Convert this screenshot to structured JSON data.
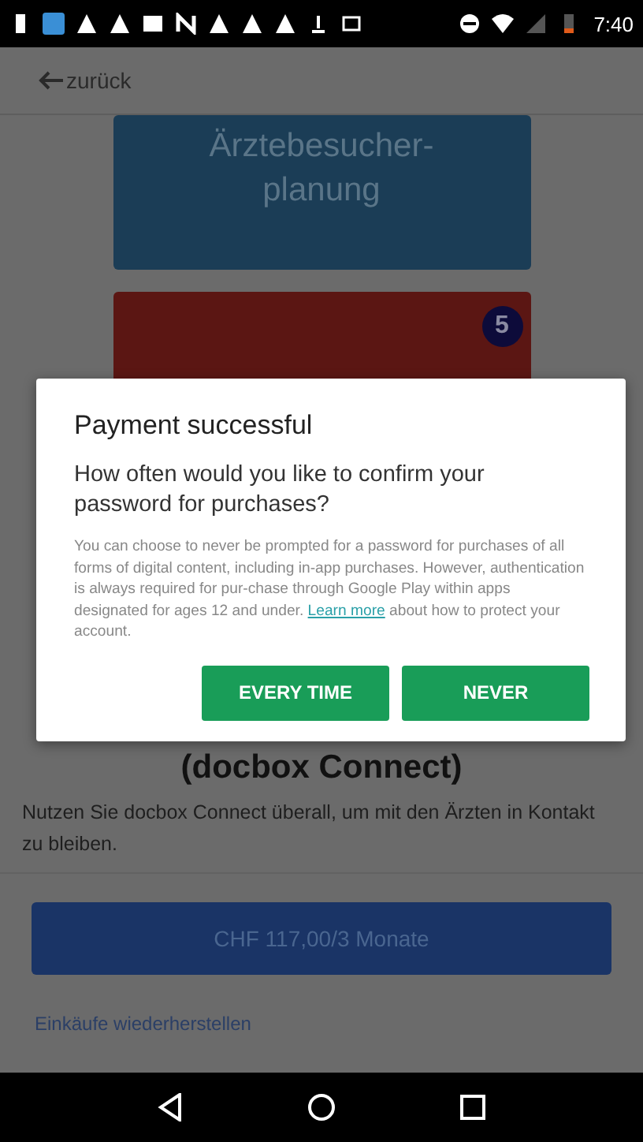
{
  "status_bar": {
    "time": "7:40"
  },
  "app_bar": {
    "back_label": "zurück"
  },
  "cards": [
    {
      "kind": "tile",
      "title": "Ärztebesucher-planung",
      "color": "#1b3d56"
    },
    {
      "kind": "tile",
      "badge": "5",
      "color": "#5b1613"
    }
  ],
  "product": {
    "title": "(docbox Connect)",
    "description": "Nutzen Sie docbox Connect überall, um mit den Ärzten in Kontakt zu bleiben.",
    "price_button": "CHF 117,00/3 Monate",
    "restore_link": "Einkäufe wiederherstellen"
  },
  "dialog": {
    "title": "Payment successful",
    "question": "How often would you like to confirm your password for purchases?",
    "body_before": "You can choose to never be prompted for a password for purchases of all forms of digital content, including in-app purchases. However, authentication is always required for pur-chase through Google Play within apps designated for ages 12 and under.",
    "link": "Learn more",
    "body_after": "about how to protect your account.",
    "buttons": [
      "EVERY TIME",
      "NEVER"
    ]
  }
}
